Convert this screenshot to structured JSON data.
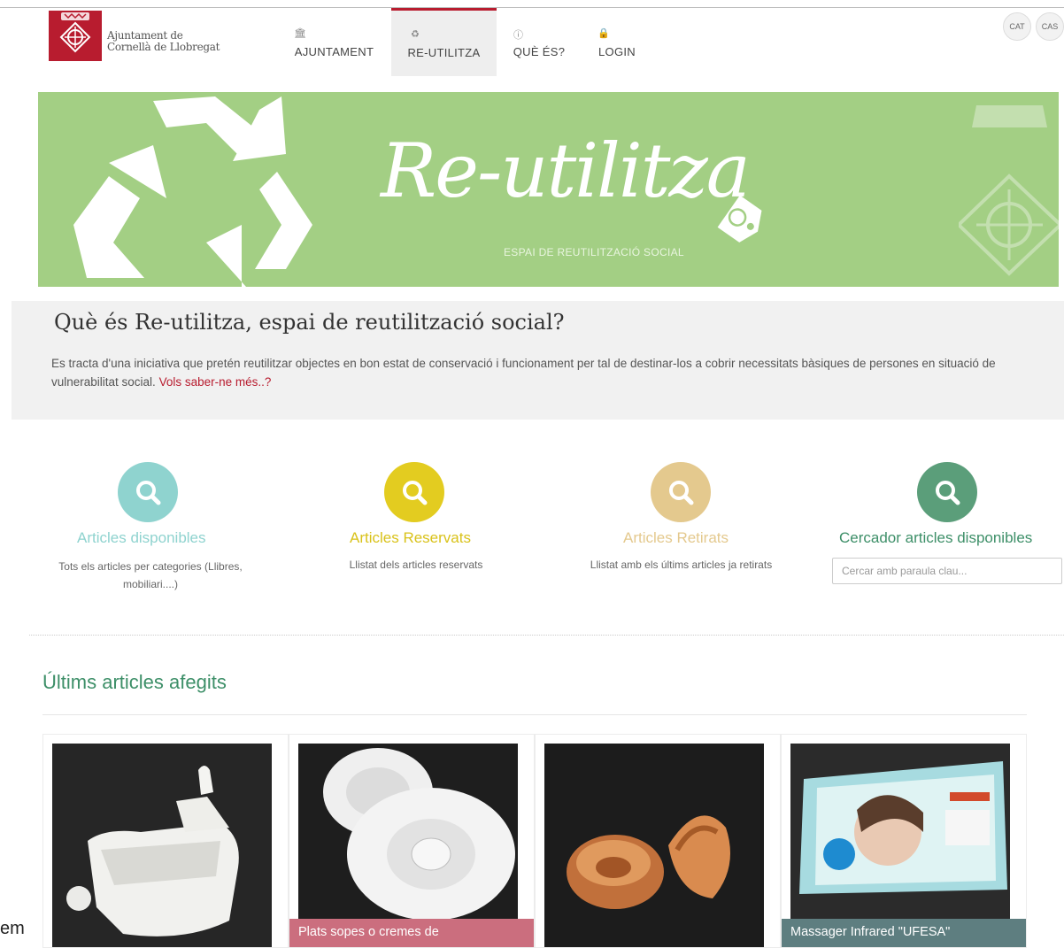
{
  "header": {
    "logo_line1": "Ajuntament de",
    "logo_line2": "Cornellà de Llobregat",
    "nav": [
      {
        "label": "AJUNTAMENT",
        "icon": "town-hall-icon"
      },
      {
        "label": "RE-UTILITZA",
        "icon": "recycle-icon",
        "active": true
      },
      {
        "label": "QUÈ ÉS?",
        "icon": "info-icon"
      },
      {
        "label": "LOGIN",
        "icon": "lock-icon"
      }
    ],
    "languages": [
      "CAT",
      "CAS"
    ]
  },
  "banner": {
    "title": "Re-utilitza",
    "subtitle": "ESPAI DE REUTILITZACIÓ SOCIAL",
    "background": "#a3cf84"
  },
  "intro": {
    "heading": "Què és Re-utilitza, espai de reutilització social?",
    "text": "Es tracta d'una iniciativa que pretén reutilitzar objectes en bon estat de conservació i funcionament per tal de destinar-los a cobrir necessitats bàsiques de persones en situació de vulnerabilitat social. ",
    "link": "Vols saber-ne més..?"
  },
  "features": [
    {
      "title": "Articles disponibles",
      "desc": "Tots els articles per categories (Llibres, mobiliari....)",
      "color": "#8fd3cf"
    },
    {
      "title": "Articles Reservats",
      "desc": "Llistat dels articles reservats",
      "color": "#e3cc20"
    },
    {
      "title": "Articles Retirats",
      "desc": "Llistat amb els últims articles ja retirats",
      "color": "#e4c98e"
    },
    {
      "title": "Cercador articles disponibles",
      "placeholder": "Cercar amb paraula clau...",
      "color": "#5b9e7a"
    }
  ],
  "latest": {
    "title": "Últims articles afegits",
    "cards": [
      {
        "caption": ""
      },
      {
        "caption": "Plats sopes o cremes de"
      },
      {
        "caption": ""
      },
      {
        "caption": "Massager Infrared \"UFESA\""
      }
    ]
  },
  "edge_text": "em"
}
